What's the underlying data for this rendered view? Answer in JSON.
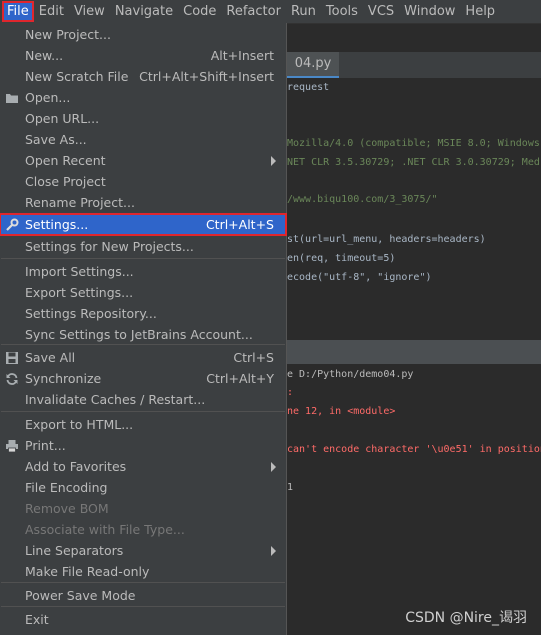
{
  "menubar": [
    "File",
    "Edit",
    "View",
    "Navigate",
    "Code",
    "Refactor",
    "Run",
    "Tools",
    "VCS",
    "Window",
    "Help"
  ],
  "editor": {
    "tab_label": "04.py",
    "lines": [
      {
        "text": "request",
        "color": "#a9b7c6"
      },
      {
        "text": "Mozilla/4.0 (compatible; MSIE 8.0; Windows",
        "color": "#6a8759"
      },
      {
        "text": "NET CLR 3.5.30729; .NET CLR 3.0.30729; Med",
        "color": "#6a8759"
      },
      {
        "text": "/www.biqu100.com/3_3075/\"",
        "color": "#6a8759"
      },
      {
        "text": "st(url=url_menu, headers=headers)",
        "color": "#a9b7c6"
      },
      {
        "text": "en(req, timeout=5)",
        "color": "#a9b7c6"
      },
      {
        "text": "ecode(\"utf-8\", \"ignore\")",
        "color": "#a9b7c6"
      }
    ]
  },
  "console": {
    "lines": [
      {
        "text": "e D:/Python/demo04.py",
        "color": "#bbbbbb"
      },
      {
        "text": ":",
        "color": "#ff6b68"
      },
      {
        "text": "ne 12, in <module>",
        "color": "#ff6b68"
      },
      {
        "text": "can't encode character '\\u0e51' in position",
        "color": "#ff6b68"
      },
      {
        "text": "1",
        "color": "#bbbbbb"
      }
    ]
  },
  "file_menu": {
    "items": [
      {
        "label": "New Project...",
        "shortcut": "",
        "icon": "",
        "submenu": false,
        "disabled": false
      },
      {
        "label": "New...",
        "shortcut": "Alt+Insert",
        "icon": "",
        "submenu": false,
        "disabled": false
      },
      {
        "label": "New Scratch File",
        "shortcut": "Ctrl+Alt+Shift+Insert",
        "icon": "",
        "submenu": false,
        "disabled": false
      },
      {
        "label": "Open...",
        "shortcut": "",
        "icon": "folder-icon",
        "submenu": false,
        "disabled": false
      },
      {
        "label": "Open URL...",
        "shortcut": "",
        "icon": "",
        "submenu": false,
        "disabled": false
      },
      {
        "label": "Save As...",
        "shortcut": "",
        "icon": "",
        "submenu": false,
        "disabled": false
      },
      {
        "label": "Open Recent",
        "shortcut": "",
        "icon": "",
        "submenu": true,
        "disabled": false
      },
      {
        "label": "Close Project",
        "shortcut": "",
        "icon": "",
        "submenu": false,
        "disabled": false
      },
      {
        "label": "Rename Project...",
        "shortcut": "",
        "icon": "",
        "submenu": false,
        "disabled": false
      },
      {
        "label": "Settings...",
        "shortcut": "Ctrl+Alt+S",
        "icon": "wrench-icon",
        "submenu": false,
        "disabled": false,
        "selected": true
      },
      {
        "label": "Settings for New Projects...",
        "shortcut": "",
        "icon": "",
        "submenu": false,
        "disabled": false
      },
      {
        "label": "Import Settings...",
        "shortcut": "",
        "icon": "",
        "submenu": false,
        "disabled": false
      },
      {
        "label": "Export Settings...",
        "shortcut": "",
        "icon": "",
        "submenu": false,
        "disabled": false
      },
      {
        "label": "Settings Repository...",
        "shortcut": "",
        "icon": "",
        "submenu": false,
        "disabled": false
      },
      {
        "label": "Sync Settings to JetBrains Account...",
        "shortcut": "",
        "icon": "",
        "submenu": false,
        "disabled": false
      },
      {
        "label": "Save All",
        "shortcut": "Ctrl+S",
        "icon": "save-icon",
        "submenu": false,
        "disabled": false
      },
      {
        "label": "Synchronize",
        "shortcut": "Ctrl+Alt+Y",
        "icon": "sync-icon",
        "submenu": false,
        "disabled": false
      },
      {
        "label": "Invalidate Caches / Restart...",
        "shortcut": "",
        "icon": "",
        "submenu": false,
        "disabled": false
      },
      {
        "label": "Export to HTML...",
        "shortcut": "",
        "icon": "",
        "submenu": false,
        "disabled": false
      },
      {
        "label": "Print...",
        "shortcut": "",
        "icon": "print-icon",
        "submenu": false,
        "disabled": false
      },
      {
        "label": "Add to Favorites",
        "shortcut": "",
        "icon": "",
        "submenu": true,
        "disabled": false
      },
      {
        "label": "File Encoding",
        "shortcut": "",
        "icon": "",
        "submenu": false,
        "disabled": false
      },
      {
        "label": "Remove BOM",
        "shortcut": "",
        "icon": "",
        "submenu": false,
        "disabled": true
      },
      {
        "label": "Associate with File Type...",
        "shortcut": "",
        "icon": "",
        "submenu": false,
        "disabled": true
      },
      {
        "label": "Line Separators",
        "shortcut": "",
        "icon": "",
        "submenu": true,
        "disabled": false
      },
      {
        "label": "Make File Read-only",
        "shortcut": "",
        "icon": "",
        "submenu": false,
        "disabled": false
      },
      {
        "label": "Power Save Mode",
        "shortcut": "",
        "icon": "",
        "submenu": false,
        "disabled": false
      },
      {
        "label": "Exit",
        "shortcut": "",
        "icon": "",
        "submenu": false,
        "disabled": false
      }
    ]
  },
  "watermark": "CSDN @Nire_谒羽",
  "colors": {
    "selection": "#2f65ca",
    "highlight_border": "#e0262d",
    "menu_bg": "#3c3f41"
  }
}
